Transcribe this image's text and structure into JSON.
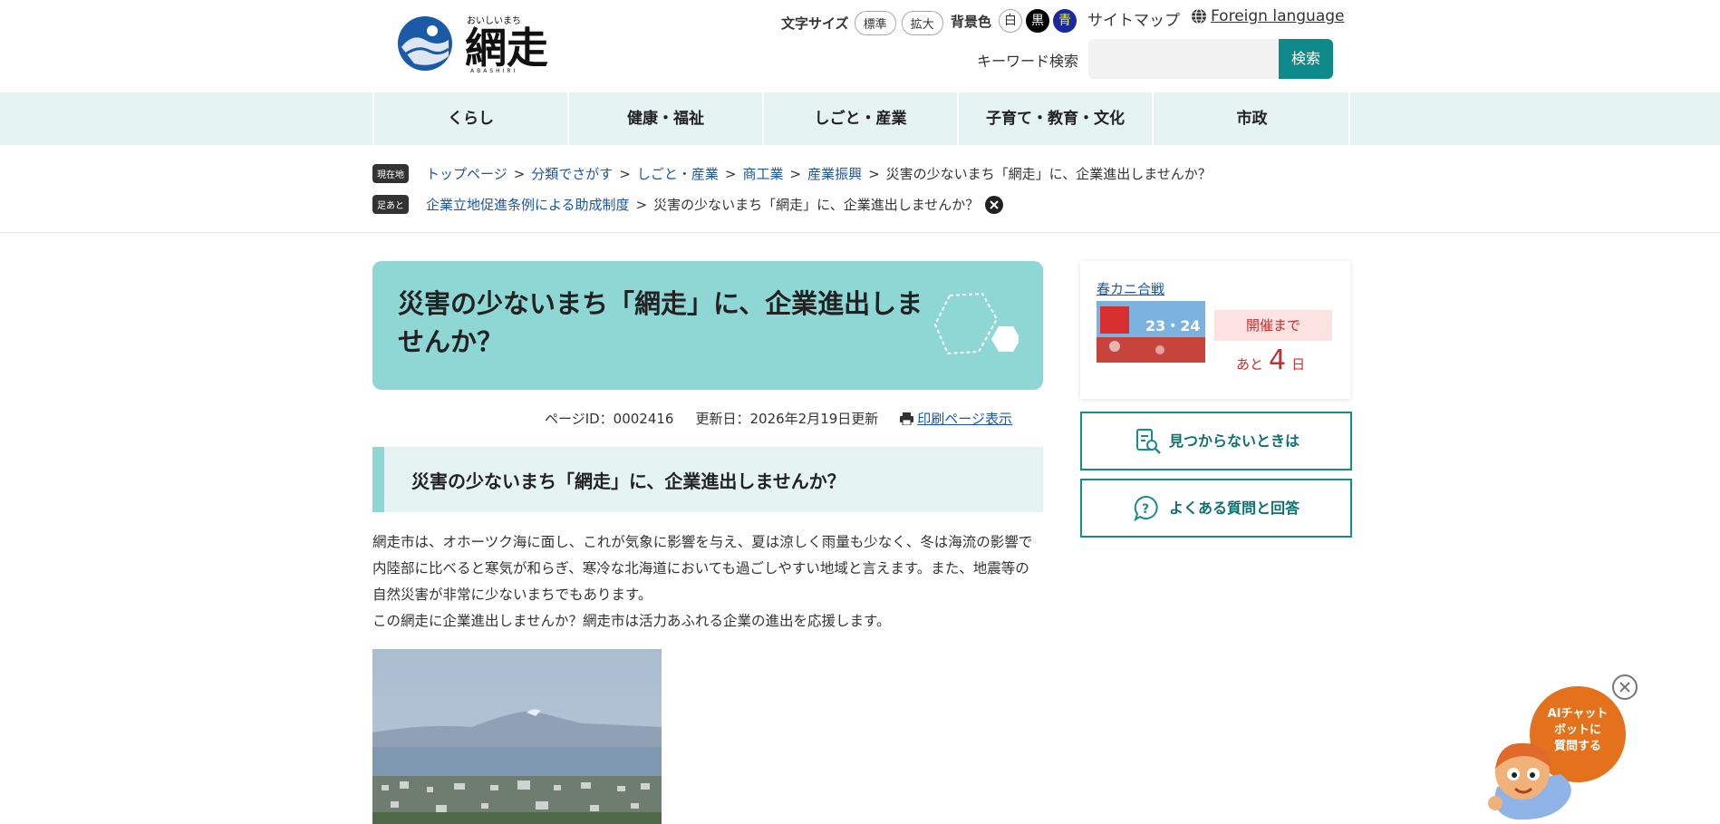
{
  "header": {
    "logo_alt": "網走",
    "logo_ruby": "おいしいまち",
    "logo_roman": "ABASHIRI",
    "text_size_label": "文字サイズ",
    "text_size_options": [
      "標準",
      "拡大"
    ],
    "bg_color_label": "背景色",
    "bg_color_options": [
      "白",
      "黒",
      "青"
    ],
    "sitemap": "サイトマップ",
    "foreign_language": "Foreign language",
    "search_label": "キーワード検索",
    "search_placeholder": "",
    "search_button": "検索"
  },
  "nav": [
    "くらし",
    "健康・福祉",
    "しごと・産業",
    "子育て・教育・文化",
    "市政"
  ],
  "breadcrumb": {
    "current_tag": "現在地",
    "current": [
      "トップページ",
      "分類でさがす",
      "しごと・産業",
      "商工業",
      "産業振興"
    ],
    "current_page": "災害の少ないまち「網走」に、企業進出しませんか？",
    "history_tag": "足あと",
    "history": [
      "企業立地促進条例による助成制度"
    ],
    "history_page": "災害の少ないまち「網走」に、企業進出しませんか？",
    "separator": ">"
  },
  "main": {
    "title": "災害の少ないまち「網走」に、企業進出しませんか？",
    "page_id": "ページID：0002416",
    "updated": "更新日：2026年2月19日更新",
    "print": "印刷ページ表示",
    "heading": "災害の少ないまち「網走」に、企業進出しませんか？",
    "paragraph1": "網走市は、オホーツク海に面し、これが気象に影響を与え、夏は涼しく雨量も少なく、冬は海流の影響で内陸部に比べると寒気が和らぎ、寒冷な北海道においても過ごしやすい地域と言えます。また、地震等の自然災害が非常に少ないまちでもあります。",
    "paragraph2": "この網走に企業進出しませんか？網走市は活力あふれる企業の進出を応援します。"
  },
  "sidebar": {
    "event_link": "春カニ合戦",
    "banner_text": "23・24",
    "countdown_label": "開催まで",
    "countdown_prefix": "あと",
    "countdown_number": "4",
    "countdown_unit": "日",
    "not_found": "見つからないときは",
    "faq": "よくある質問と回答"
  },
  "chatbot": {
    "label": "AIチャットボットに質問する",
    "lines": [
      "AIチャット",
      "ボットに",
      "質問する"
    ]
  },
  "colors": {
    "accent": "#8fd7d5",
    "nav_bg": "#e5f3f3",
    "button": "#0f8a8a",
    "chat_bubble": "#e4711b"
  }
}
